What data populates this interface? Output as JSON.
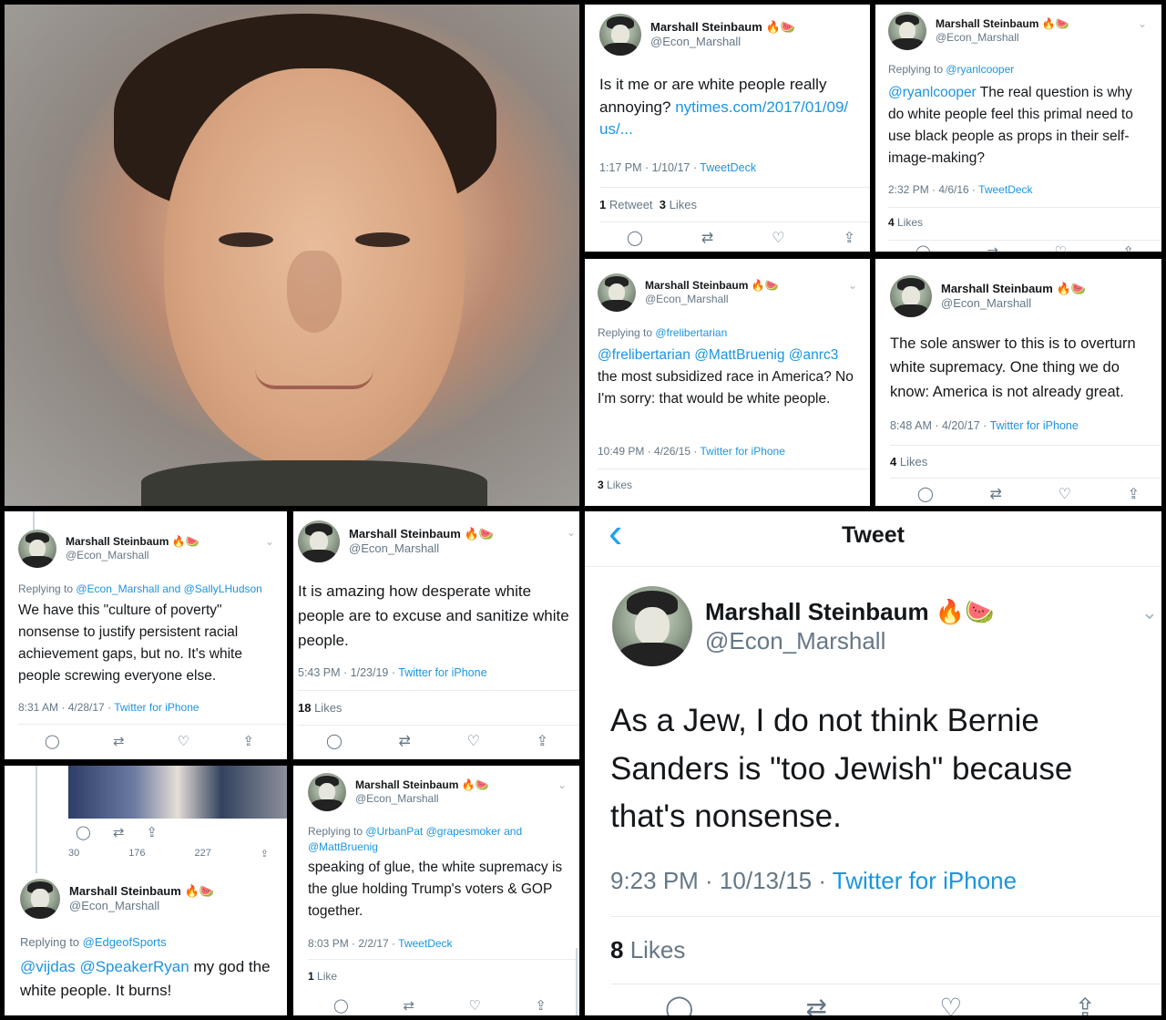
{
  "author": {
    "name": "Marshall Steinbaum",
    "handle": "@Econ_Marshall",
    "emoji": "🔥🍉"
  },
  "actions": {
    "reply": "◯",
    "retweet": "⇄",
    "like": "♡",
    "share": "⇪"
  },
  "tweets": {
    "t1": {
      "text": "Is it me or are white people really annoying? ",
      "link": "nytimes.com/2017/01/09/ us/...",
      "time": "1:17 PM · 1/10/17 · ",
      "client": "TweetDeck",
      "rt_count": "1",
      "rt_label": " Retweet",
      "likes_count": "3",
      "likes_label": " Likes"
    },
    "t2": {
      "replying": "Replying to ",
      "replying_to": "@ryanlcooper",
      "mention": "@ryanlcooper",
      "text": " The real question is why do white people feel this primal need to use black people as props in their self-image-making?",
      "time": "2:32 PM · 4/6/16 · ",
      "client": "TweetDeck",
      "likes_count": "4",
      "likes_label": " Likes"
    },
    "t3": {
      "replying": "Replying to ",
      "replying_to": "@frelibertarian",
      "mentions": "@frelibertarian @MattBruenig @anrc3",
      "text": "the most subsidized race in America? No I'm sorry: that would be white people.",
      "time": "10:49 PM · 4/26/15 · ",
      "client": "Twitter for iPhone",
      "likes_count": "3",
      "likes_label": " Likes"
    },
    "t4": {
      "text": "The sole answer to this is to overturn white supremacy. One thing we do know: America is not already great.",
      "time": "8:48 AM · 4/20/17 · ",
      "client": "Twitter for iPhone",
      "likes_count": "4",
      "likes_label": " Likes"
    },
    "t5": {
      "replying": "Replying to ",
      "replying_to": "@Econ_Marshall and @SallyLHudson",
      "text": "We have this \"culture of poverty\" nonsense to justify persistent racial achievement gaps, but no. It's white people screwing everyone else.",
      "time": "8:31 AM · 4/28/17 · ",
      "client": "Twitter for iPhone"
    },
    "t6": {
      "text": "It is amazing how desperate white people are to excuse and sanitize white people.",
      "time": "5:43 PM · 1/23/19 · ",
      "client": "Twitter for iPhone",
      "likes_count": "18",
      "likes_label": " Likes"
    },
    "t7": {
      "counts": {
        "replies": "30",
        "retweets": "176",
        "likes": "227"
      },
      "replying": "Replying to ",
      "replying_to": "@EdgeofSports",
      "mentions": "@vijdas @SpeakerRyan",
      "text": " my god the white people. It burns!"
    },
    "t8": {
      "replying": "Replying to ",
      "replying_to": "@UrbanPat @grapesmoker and @MattBruenig",
      "text": "speaking of glue, the white supremacy is the glue holding Trump's voters & GOP together.",
      "time": "8:03 PM · 2/2/17 · ",
      "client": "TweetDeck",
      "likes_count": "1",
      "likes_label": " Like"
    },
    "t9": {
      "header": "Tweet",
      "back": "‹",
      "text": "As a Jew, I do not think Bernie Sanders is \"too Jewish\" because that's nonsense.",
      "time": "9:23 PM · 10/13/15 · ",
      "client": "Twitter for iPhone",
      "likes_count": "8",
      "likes_label": " Likes"
    }
  },
  "colors": {
    "link": "#1b95e0",
    "meta": "#657786",
    "text": "#14171a"
  }
}
